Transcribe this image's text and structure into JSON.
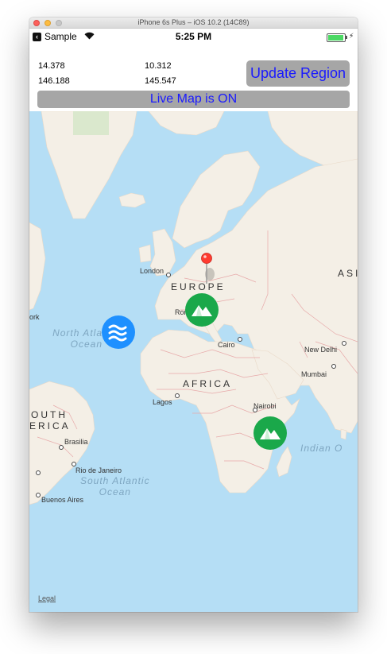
{
  "window": {
    "title": "iPhone 6s Plus – iOS 10.2 (14C89)"
  },
  "status_bar": {
    "back_app": "Sample",
    "time": "5:25 PM",
    "wifi_icon": "wifi-icon",
    "battery_icon": "battery-full-icon"
  },
  "coordinates": {
    "values": [
      "14.378",
      "10.312",
      "146.188",
      "145.547"
    ]
  },
  "buttons": {
    "update_region": "Update Region"
  },
  "live_map": {
    "status": "Live Map is ON"
  },
  "map": {
    "regions": [
      "EUROPE",
      "AFRICA",
      "ASIA",
      "OUTH",
      "ERICA"
    ],
    "oceans": {
      "north_atlantic": "North Atla\nOcean",
      "south_atlantic": "South Atlantic\nOcean",
      "indian": "Indian O"
    },
    "cities": [
      "London",
      "Rome",
      "Cairo",
      "New Delhi",
      "Mumbai",
      "Lagos",
      "Nairobi",
      "Brasilia",
      "Rio de Janeiro",
      "Buenos Aires",
      "ork"
    ],
    "legal": "Legal",
    "colors": {
      "water": "#b5def5",
      "land": "#f4efe6",
      "border": "#e7a9a9",
      "green_marker": "#1aa84a",
      "blue_marker": "#1e90ff",
      "pin": "#ff3b30"
    },
    "annotations": [
      {
        "type": "mountain",
        "icon": "mountain-icon"
      },
      {
        "type": "mountain",
        "icon": "mountain-icon"
      },
      {
        "type": "water",
        "icon": "waves-icon"
      },
      {
        "type": "pin",
        "icon": "map-pin-icon"
      }
    ]
  }
}
